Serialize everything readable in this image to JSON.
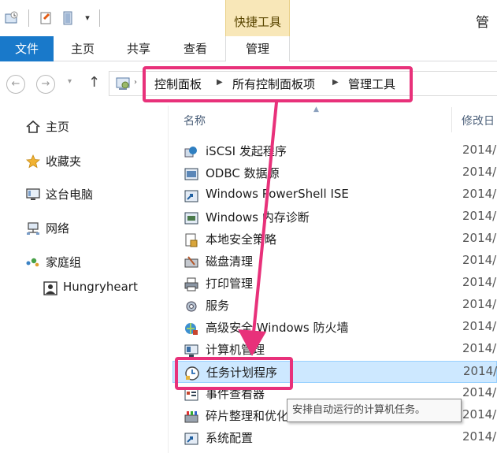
{
  "window": {
    "title": "管",
    "contextual_tab_group": "快捷工具",
    "quick_access": [
      "properties-icon",
      "new-folder-icon",
      "undo-icon",
      "dropdown-icon"
    ]
  },
  "ribbon": {
    "tabs": [
      {
        "label": "文件",
        "active": false
      },
      {
        "label": "主页",
        "active": false
      },
      {
        "label": "共享",
        "active": false
      },
      {
        "label": "查看",
        "active": false
      },
      {
        "label": "管理",
        "active": true
      }
    ]
  },
  "address_bar": {
    "breadcrumb": [
      "控制面板",
      "所有控制面板项",
      "管理工具"
    ],
    "location_icon": "control-panel-icon"
  },
  "columns": {
    "name": "名称",
    "date_modified": "修改日"
  },
  "sidebar": {
    "items": [
      {
        "label": "主页",
        "icon": "home-icon"
      },
      {
        "label": "收藏夹",
        "icon": "star-icon"
      },
      {
        "label": "这台电脑",
        "icon": "computer-icon"
      },
      {
        "label": "网络",
        "icon": "network-icon"
      },
      {
        "label": "家庭组",
        "icon": "homegroup-icon"
      },
      {
        "label": "Hungryheart",
        "icon": "user-icon"
      }
    ]
  },
  "files": [
    {
      "name": "iSCSI 发起程序",
      "date": "2014/"
    },
    {
      "name": "ODBC 数据源",
      "date": "2014/"
    },
    {
      "name": "Windows PowerShell ISE",
      "date": "2014/"
    },
    {
      "name": "Windows 内存诊断",
      "date": "2014/"
    },
    {
      "name": "本地安全策略",
      "date": "2014/"
    },
    {
      "name": "磁盘清理",
      "date": "2014/"
    },
    {
      "name": "打印管理",
      "date": "2014/"
    },
    {
      "name": "服务",
      "date": "2014/"
    },
    {
      "name": "高级安全 Windows 防火墙",
      "date": "2014/"
    },
    {
      "name": "计算机管理",
      "date": "2014/"
    },
    {
      "name": "任务计划程序",
      "date": "2014/",
      "selected": true
    },
    {
      "name": "事件查看器",
      "date": "2014/"
    },
    {
      "name": "碎片整理和优化驱动器",
      "date": "2014/"
    },
    {
      "name": "系统配置",
      "date": "2014/"
    }
  ],
  "tooltip": "安排自动运行的计算机任务。",
  "annotation_color": "#e8317a",
  "accent_color": "#1979ca",
  "selection_color": "#cde8ff"
}
